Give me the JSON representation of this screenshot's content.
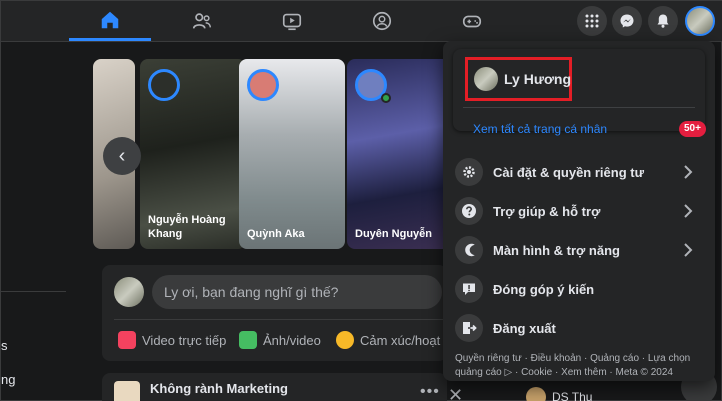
{
  "left_sidebar": {
    "fragment_1": "s",
    "fragment_2": "ng"
  },
  "stories": [
    {
      "name": "",
      "ring": false
    },
    {
      "name": "Nguyễn Hoàng Khang",
      "ring": true
    },
    {
      "name": "Quỳnh Aka",
      "ring": true
    },
    {
      "name": "Duyên Nguyễn",
      "ring": true,
      "online": true
    }
  ],
  "story_prev_symbol": "‹",
  "composer": {
    "placeholder": "Ly ơi, bạn đang nghĩ gì thế?",
    "actions": [
      {
        "label": "Video trực tiếp",
        "color": "#f3425f"
      },
      {
        "label": "Ảnh/video",
        "color": "#45bd62"
      },
      {
        "label": "Cảm xúc/hoạt độ",
        "color": "#f7b928"
      }
    ]
  },
  "post": {
    "title": "Không rành Marketing",
    "more_symbol": "•••"
  },
  "post_close_symbol": "✕",
  "contact": {
    "name": "DS Thu"
  },
  "account_menu": {
    "profile_name": "Ly Hương",
    "see_all_label": "Xem tất cả trang cá nhân",
    "badge": "50+",
    "items": [
      {
        "label": "Cài đặt & quyền riêng tư",
        "icon": "gear-icon",
        "chevron": true
      },
      {
        "label": "Trợ giúp & hỗ trợ",
        "icon": "help-icon",
        "chevron": true
      },
      {
        "label": "Màn hình & trợ năng",
        "icon": "moon-icon",
        "chevron": true
      },
      {
        "label": "Đóng góp ý kiến",
        "icon": "feedback-icon",
        "chevron": false
      },
      {
        "label": "Đăng xuất",
        "icon": "logout-icon",
        "chevron": false
      }
    ],
    "footer": "Quyền riêng tư · Điều khoản · Quảng cáo · Lựa chọn quảng cáo ▷ · Cookie · Xem thêm · Meta © 2024"
  },
  "colors": {
    "accent": "#2d88ff",
    "highlight_border": "#e41e26",
    "badge": "#e41e3f",
    "background": "#18191a",
    "surface": "#242526"
  }
}
